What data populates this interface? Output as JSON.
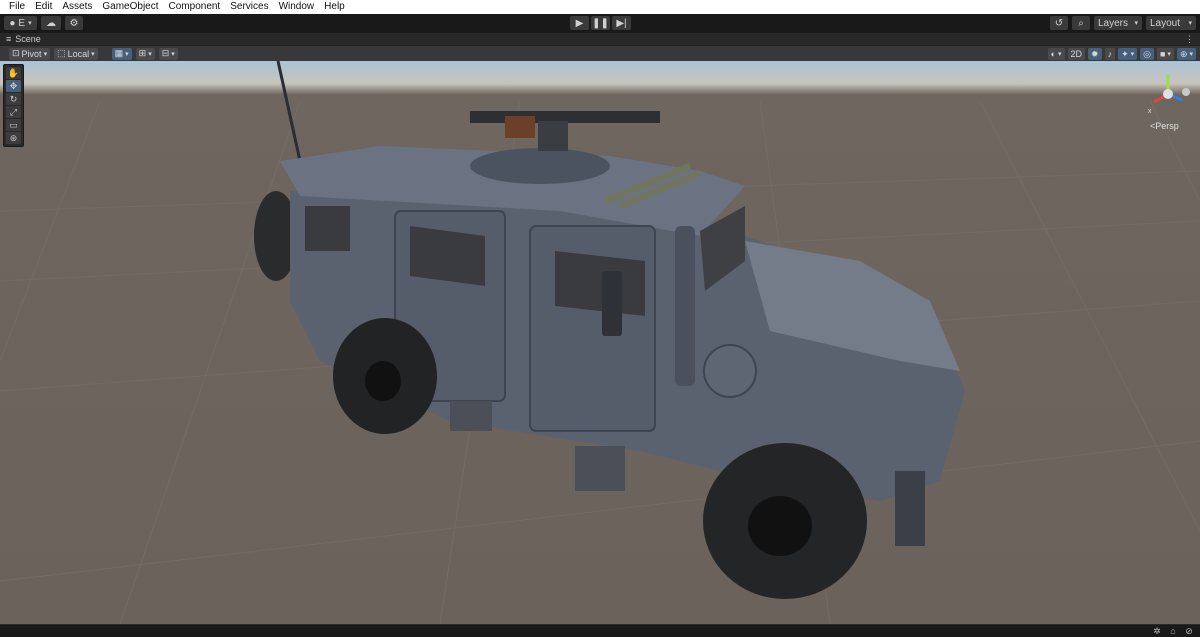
{
  "menu": [
    "File",
    "Edit",
    "Assets",
    "GameObject",
    "Component",
    "Services",
    "Window",
    "Help"
  ],
  "toolbar": {
    "account_label": "E",
    "layers_label": "Layers",
    "layout_label": "Layout"
  },
  "scene": {
    "tab_label": "Scene",
    "pivot_label": "Pivot",
    "local_label": "Local",
    "mode_2d": "2D",
    "persp_label": "Persp"
  },
  "colors": {
    "accent": "#46607c",
    "sky": "#a8c4d6",
    "ground": "#6b625b",
    "vehicle": "#5a6270"
  }
}
